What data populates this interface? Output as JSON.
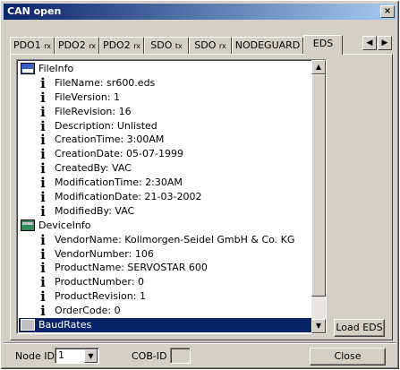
{
  "window": {
    "title": "CAN open",
    "close_glyph": "×"
  },
  "tabs": [
    {
      "label": "PDO1",
      "sub": "rx"
    },
    {
      "label": "PDO2",
      "sub": "rx"
    },
    {
      "label": "PDO2",
      "sub": "rx"
    },
    {
      "label": "SDO",
      "sub": "tx"
    },
    {
      "label": "SDO",
      "sub": "rx"
    },
    {
      "label": "NODEGUARD",
      "sub": ""
    },
    {
      "label": "EDS",
      "sub": ""
    }
  ],
  "active_tab": "EDS",
  "tree": {
    "sections": [
      {
        "label": "FileInfo",
        "icon": "eds-file-icon",
        "items": [
          "FileName: sr600.eds",
          "FileVersion: 1",
          "FileRevision: 16",
          "Description: Unlisted",
          "CreationTime: 3:00AM",
          "CreationDate: 05-07-1999",
          "CreatedBy: VAC",
          "ModificationTime: 2:30AM",
          "ModificationDate: 21-03-2002",
          "ModifiedBy: VAC"
        ]
      },
      {
        "label": "DeviceInfo",
        "icon": "device-icon",
        "items": [
          "VendorName: Kollmorgen-Seidel GmbH & Co. KG",
          "VendorNumber: 106",
          "ProductName: SERVOSTAR 600",
          "ProductNumber: 0",
          "ProductRevision: 1",
          "OrderCode: 0"
        ]
      },
      {
        "label": "BaudRates",
        "icon": "baudrates-icon",
        "items": [],
        "selected": true
      }
    ]
  },
  "buttons": {
    "load_eds": "Load EDS",
    "close": "Close"
  },
  "node_id": {
    "label": "Node ID",
    "value": "1"
  },
  "cob_id": {
    "label": "COB-ID",
    "value": ""
  },
  "colors": {
    "selection": "#0a246a",
    "titlebar": "#0a246a",
    "face": "#d4d0c8"
  }
}
